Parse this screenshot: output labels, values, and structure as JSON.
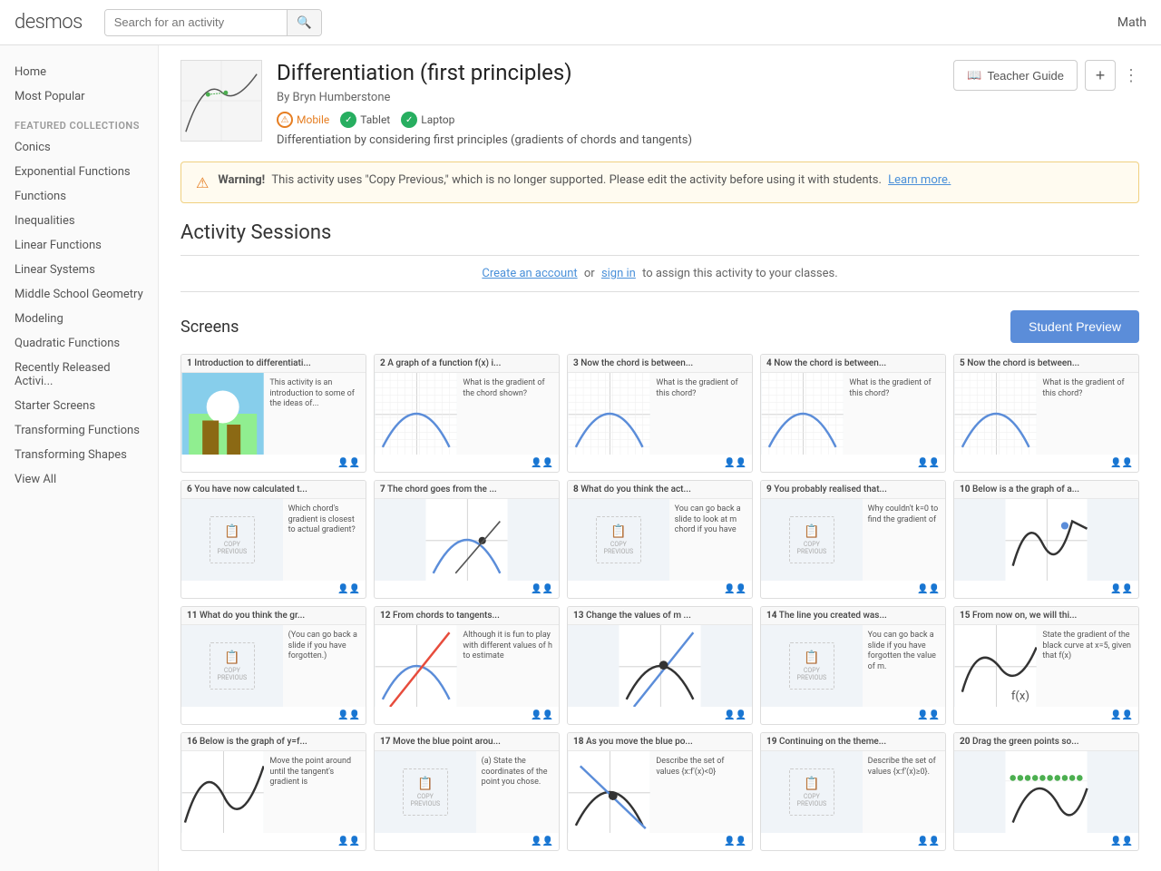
{
  "topbar": {
    "logo": "desmos",
    "search_placeholder": "Search for an activity",
    "search_value": "",
    "right_label": "Math"
  },
  "sidebar": {
    "nav_items": [
      {
        "id": "home",
        "label": "Home"
      },
      {
        "id": "most-popular",
        "label": "Most Popular"
      }
    ],
    "featured_label": "FEATURED COLLECTIONS",
    "collection_items": [
      {
        "id": "conics",
        "label": "Conics"
      },
      {
        "id": "exponential",
        "label": "Exponential Functions"
      },
      {
        "id": "functions",
        "label": "Functions"
      },
      {
        "id": "inequalities",
        "label": "Inequalities"
      },
      {
        "id": "linear-functions",
        "label": "Linear Functions"
      },
      {
        "id": "linear-systems",
        "label": "Linear Systems"
      },
      {
        "id": "middle-school",
        "label": "Middle School Geometry"
      },
      {
        "id": "modeling",
        "label": "Modeling"
      },
      {
        "id": "quadratic",
        "label": "Quadratic Functions"
      },
      {
        "id": "recently-released",
        "label": "Recently Released Activi..."
      },
      {
        "id": "starter-screens",
        "label": "Starter Screens"
      },
      {
        "id": "transforming-functions",
        "label": "Transforming Functions"
      },
      {
        "id": "transforming-shapes",
        "label": "Transforming Shapes"
      },
      {
        "id": "view-all",
        "label": "View All"
      }
    ]
  },
  "activity": {
    "title": "Differentiation (first principles)",
    "author": "By Bryn Humberstone",
    "badges": [
      {
        "id": "mobile",
        "label": "Mobile",
        "type": "warning"
      },
      {
        "id": "tablet",
        "label": "Tablet",
        "type": "success"
      },
      {
        "id": "laptop",
        "label": "Laptop",
        "type": "success"
      }
    ],
    "description": "Differentiation by considering first principles (gradients of chords and tangents)",
    "teacher_guide_label": "Teacher Guide",
    "plus_label": "+",
    "more_label": "⋮"
  },
  "warning": {
    "text_before": "This activity uses \"Copy Previous,\" which is no longer supported. Please edit the activity before using it with students.",
    "link_text": "Learn more.",
    "bold_label": "Warning!"
  },
  "sessions": {
    "section_title": "Activity Sessions",
    "create_label": "Create an account",
    "or_text": "or",
    "sign_in_label": "sign in",
    "assign_text": "to assign this activity to your classes."
  },
  "screens": {
    "title": "Screens",
    "preview_button": "Student Preview",
    "items": [
      {
        "num": "1",
        "title": "Introduction to differentiati...",
        "desc": "This activity is an introduction to some of the ideas of...",
        "type": "image"
      },
      {
        "num": "2",
        "title": "A graph of a function f(x) i...",
        "desc": "What is the gradient of the chord shown?",
        "type": "graph-parabola"
      },
      {
        "num": "3",
        "title": "Now the chord is between...",
        "desc": "What is the gradient of this chord?",
        "type": "graph-parabola"
      },
      {
        "num": "4",
        "title": "Now the chord is between...",
        "desc": "What is the gradient of this chord?",
        "type": "graph-parabola"
      },
      {
        "num": "5",
        "title": "Now the chord is between...",
        "desc": "What is the gradient of this chord?",
        "type": "graph-parabola"
      },
      {
        "num": "6",
        "title": "You have now calculated t...",
        "desc": "Which chord's gradient is closest to actual gradient?",
        "type": "copy-previous"
      },
      {
        "num": "7",
        "title": "The chord goes from the ...",
        "desc": "",
        "type": "graph-parabola-dot"
      },
      {
        "num": "8",
        "title": "What do you think the act...",
        "desc": "You can go back a slide to look at m chord if you have",
        "type": "copy-previous"
      },
      {
        "num": "9",
        "title": "You probably realised that...",
        "desc": "Why couldn't k=0 to find the gradient of",
        "type": "copy-previous"
      },
      {
        "num": "10",
        "title": "Below is a the graph of a...",
        "desc": "",
        "type": "graph-curve"
      },
      {
        "num": "11",
        "title": "What do you think the gr...",
        "desc": "(You can go back a slide if you have forgotten.)",
        "type": "copy-previous"
      },
      {
        "num": "12",
        "title": "From chords to tangents...",
        "desc": "Although it is fun to play with different values of h to estimate",
        "type": "graph-parabola-red"
      },
      {
        "num": "13",
        "title": "Change the values of m ...",
        "desc": "",
        "type": "graph-line-dot"
      },
      {
        "num": "14",
        "title": "The line you created was...",
        "desc": "You can go back a slide if you have forgotten the value of m.",
        "type": "copy-previous"
      },
      {
        "num": "15",
        "title": "From now on, we will thi...",
        "desc": "State the gradient of the black curve at x=5, given that f(x)",
        "type": "graph-fx"
      },
      {
        "num": "16",
        "title": "Below is the graph of y=f...",
        "desc": "Move the point around until the tangent's gradient is",
        "type": "graph-curve2"
      },
      {
        "num": "17",
        "title": "Move the blue point arou...",
        "desc": "(a) State the coordinates of the point you chose.",
        "type": "copy-previous"
      },
      {
        "num": "18",
        "title": "As you move the blue po...",
        "desc": "Describe the set of values {x:f'(x)<0}",
        "type": "graph-line-dot2"
      },
      {
        "num": "19",
        "title": "Continuing on the theme...",
        "desc": "Describe the set of values {x:f'(x)≥0}.",
        "type": "copy-previous"
      },
      {
        "num": "20",
        "title": "Drag the green points so...",
        "desc": "",
        "type": "graph-dots-curve"
      }
    ]
  }
}
